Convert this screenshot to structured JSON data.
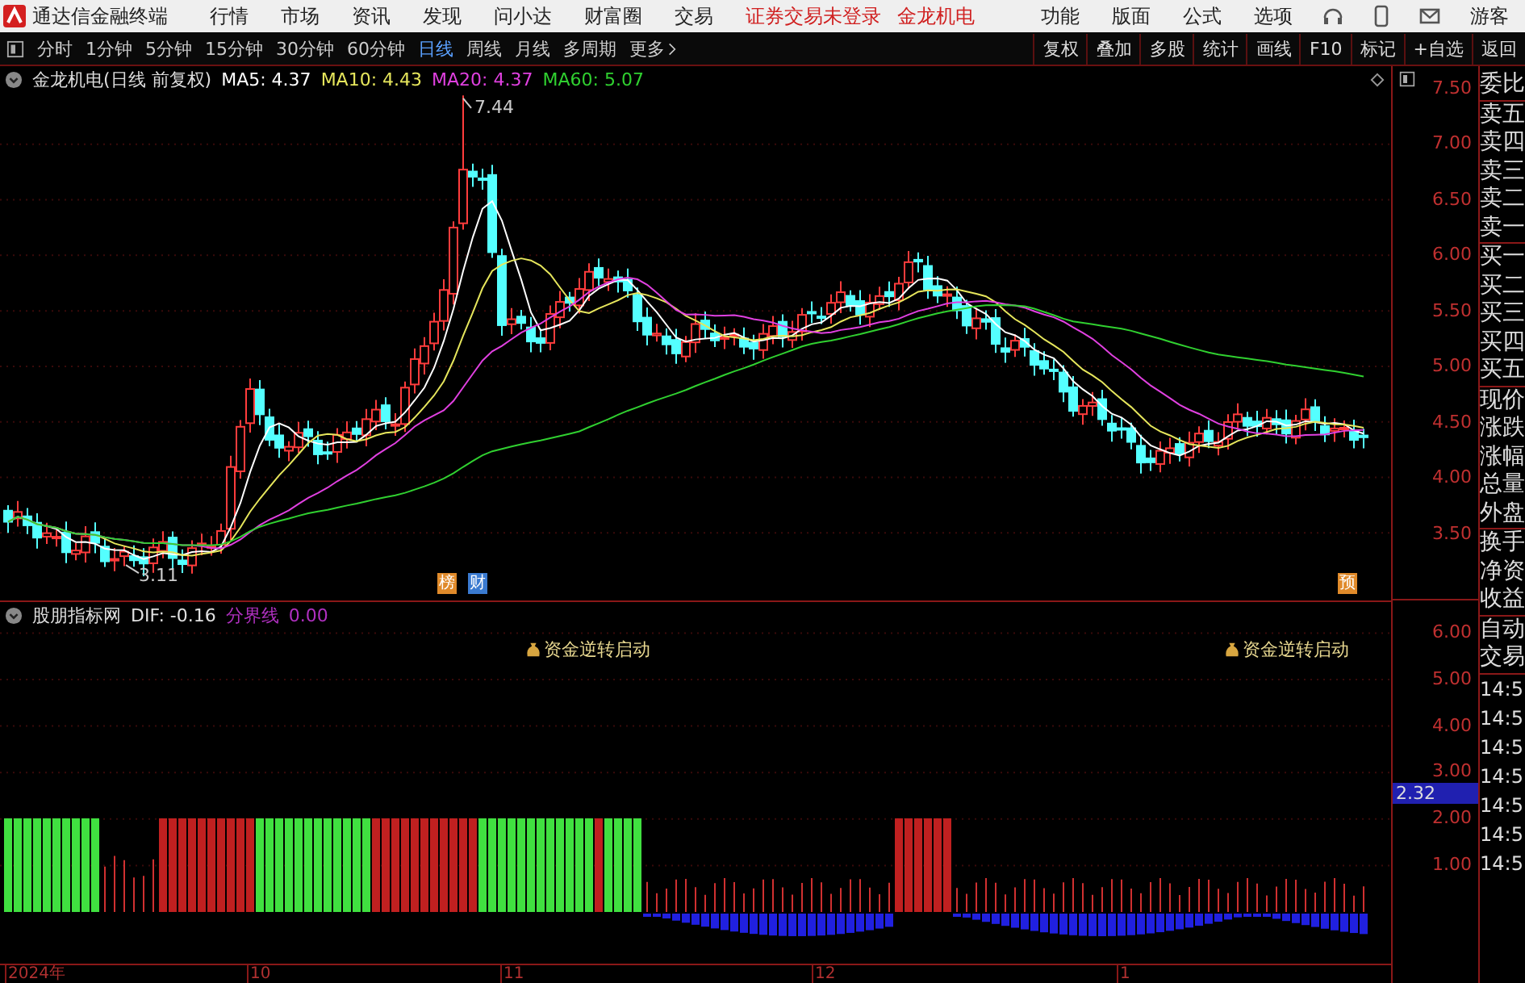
{
  "app_bar": {
    "title": "通达信金融终端",
    "menu": [
      "行情",
      "市场",
      "资讯",
      "发现",
      "问小达",
      "财富圈",
      "交易"
    ],
    "notice": "证券交易未登录",
    "stock": "金龙机电",
    "tools": [
      "功能",
      "版面",
      "公式",
      "选项"
    ],
    "user": "游客"
  },
  "toolbar": {
    "periods": [
      {
        "label": "分时",
        "selected": false
      },
      {
        "label": "1分钟",
        "selected": false
      },
      {
        "label": "5分钟",
        "selected": false
      },
      {
        "label": "15分钟",
        "selected": false
      },
      {
        "label": "30分钟",
        "selected": false
      },
      {
        "label": "60分钟",
        "selected": false
      },
      {
        "label": "日线",
        "selected": true
      },
      {
        "label": "周线",
        "selected": false
      },
      {
        "label": "月线",
        "selected": false
      },
      {
        "label": "多周期",
        "selected": false
      }
    ],
    "more": "更多",
    "actions": [
      "复权",
      "叠加",
      "多股",
      "统计",
      "画线",
      "F10",
      "标记",
      "+自选",
      "返回"
    ]
  },
  "price_chart": {
    "title": "金龙机电(日线 前复权)",
    "averages": [
      {
        "label": "MA5: 4.37",
        "color": "#ffffff"
      },
      {
        "label": "MA10: 4.43",
        "color": "#e6e65c"
      },
      {
        "label": "MA20: 4.37",
        "color": "#e040e0"
      },
      {
        "label": "MA60: 5.07",
        "color": "#30d030"
      }
    ],
    "high_label": "7.44",
    "low_label": "3.11",
    "badges": [
      {
        "label": "榜",
        "color": "#e08a2a"
      },
      {
        "label": "财",
        "color": "#3a7ad0"
      },
      {
        "label": "预",
        "color": "#e08a2a"
      }
    ],
    "yticks": [
      "7.50",
      "7.00",
      "6.50",
      "6.00",
      "5.50",
      "5.00",
      "4.50",
      "4.00",
      "3.50"
    ]
  },
  "indicator": {
    "name": "股朋指标网",
    "lines": [
      {
        "label": "DIF: -0.16",
        "color": "#e0e0e0"
      },
      {
        "label": "分界线",
        "color": "#b030c0"
      },
      {
        "label": "0.00",
        "color": "#b030c0"
      }
    ],
    "signals": [
      "资金逆转启动",
      "资金逆转启动"
    ],
    "yticks": [
      "6.00",
      "5.00",
      "4.00",
      "3.00",
      "2.00",
      "1.00"
    ],
    "current_value": "2.32"
  },
  "x_axis": [
    "2024年",
    "10",
    "11",
    "12",
    "1"
  ],
  "quote_panel": {
    "groups": [
      [
        "委比"
      ],
      [
        "卖五",
        "卖四",
        "卖三",
        "卖二",
        "卖一"
      ],
      [
        "买一",
        "买二",
        "买三",
        "买四",
        "买五"
      ],
      [
        "现价",
        "涨跌",
        "涨幅",
        "总量",
        "外盘"
      ],
      [
        "换手",
        "净资",
        "收益"
      ],
      [
        "自动",
        "交易"
      ]
    ],
    "times": [
      "14:5",
      "14:5",
      "14:5",
      "14:5",
      "14:5",
      "14:5",
      "14:5"
    ]
  }
}
